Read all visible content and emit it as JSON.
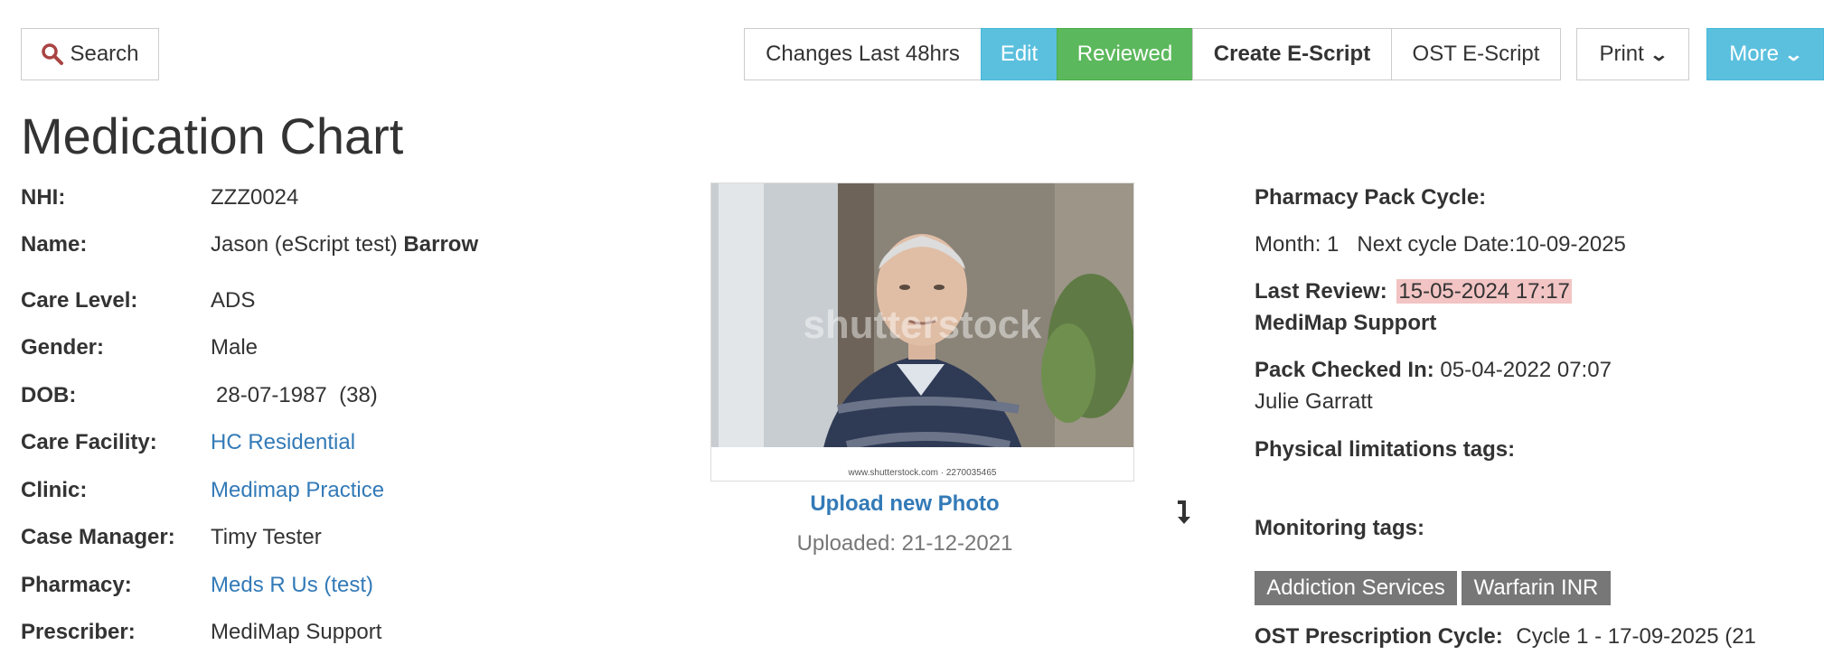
{
  "toolbar": {
    "search_label": "Search",
    "changes_label": "Changes Last 48hrs",
    "edit_label": "Edit",
    "reviewed_label": "Reviewed",
    "create_escript_label": "Create E-Script",
    "ost_escript_label": "OST E-Script",
    "print_label": "Print",
    "more_label": "More"
  },
  "page": {
    "title": "Medication Chart"
  },
  "patient": {
    "nhi_label": "NHI:",
    "nhi": "ZZZ0024",
    "name_label": "Name:",
    "name_given": "Jason (eScript test)",
    "name_family": "Barrow",
    "care_level_label": "Care Level:",
    "care_level": "ADS",
    "gender_label": "Gender:",
    "gender": "Male",
    "dob_label": "DOB:",
    "dob": "28-07-1987",
    "age": "(38)",
    "care_facility_label": "Care Facility:",
    "care_facility": "HC Residential",
    "clinic_label": "Clinic:",
    "clinic": "Medimap Practice",
    "case_manager_label": "Case Manager:",
    "case_manager": "Timy Tester",
    "pharmacy_label": "Pharmacy:",
    "pharmacy": "Meds R Us (test)",
    "prescriber_label": "Prescriber:",
    "prescriber": "MediMap Support"
  },
  "photo": {
    "watermark": "shutterstock",
    "caption_strip": "www.shutterstock.com · 2270035465",
    "upload_label": "Upload new Photo",
    "uploaded_text": "Uploaded: 21-12-2021"
  },
  "pharmacy_info": {
    "pack_cycle_label": "Pharmacy Pack Cycle:",
    "month_text": "Month: 1",
    "next_cycle_text": "Next cycle Date:10-09-2025",
    "last_review_label": "Last Review:",
    "last_review_date": "15-05-2024 17:17",
    "last_review_by": "MediMap Support",
    "pack_checked_label": "Pack Checked In:",
    "pack_checked_date": "05-04-2022 07:07",
    "pack_checked_by": "Julie Garratt",
    "physical_tags_label": "Physical limitations tags:",
    "monitoring_tags_label": "Monitoring tags:",
    "monitoring_tags": [
      "Addiction Services",
      "Warfarin INR"
    ],
    "ost_cycle_label": "OST Prescription Cycle:",
    "ost_cycle_value": "Cycle 1 - 17-09-2025 (21"
  },
  "colors": {
    "edit_bg": "#5bc0de",
    "reviewed_bg": "#5cb85c",
    "more_bg": "#5bc0de",
    "link": "#337ab7",
    "tag_bg": "#777777",
    "review_highlight": "#f2c4c4",
    "search_icon": "#a94442"
  }
}
